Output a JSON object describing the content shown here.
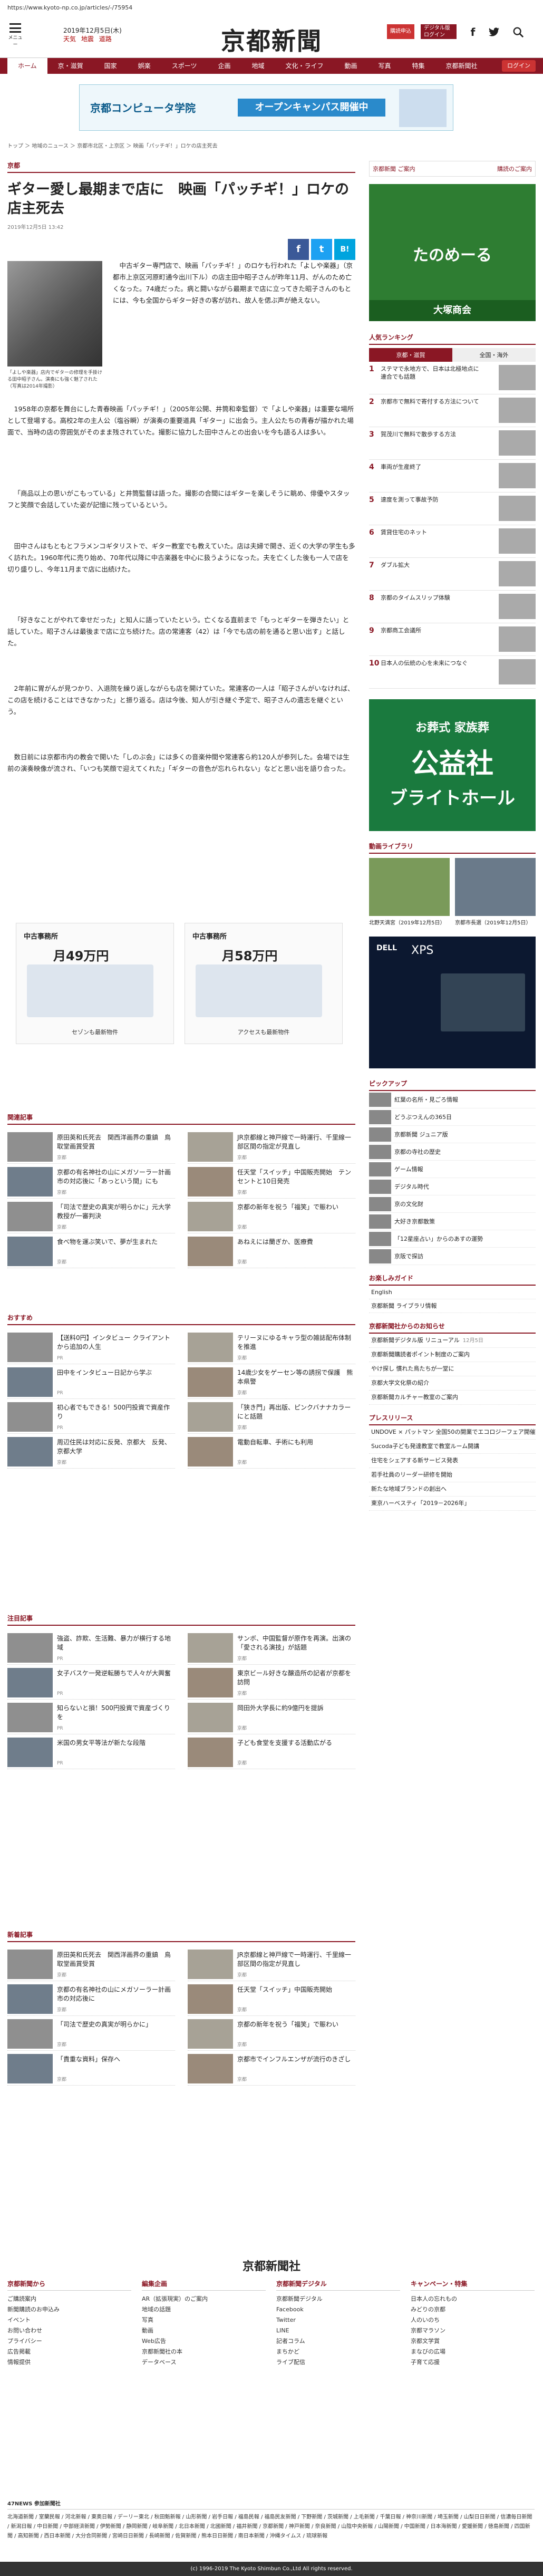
{
  "url": "https://www.kyoto-np.co.jp/articles/-/75954",
  "header": {
    "menu": "メニュー",
    "date": "2019年12月5日(木)",
    "weather": [
      "天気",
      "地震",
      "道路"
    ],
    "logo": "京都新聞",
    "btn_apply": "購読申込",
    "btn_digital": "デジタル版ログイン",
    "icons": [
      "f",
      "y",
      "search"
    ]
  },
  "nav": [
    "ホーム",
    "京・滋賀",
    "国家",
    "娯楽",
    "スポーツ",
    "企画",
    "地域",
    "文化・ライフ",
    "動画",
    "写真",
    "特集",
    "京都新聞社"
  ],
  "nav_right": "ログイン",
  "banner": {
    "title": "京都コンピュータ学院",
    "text": "オープンキャンパス開催中"
  },
  "breadcrumb": "トップ ＞ 地域のニュース ＞ 京都市北区・上京区 ＞ 映画「パッチギ！」ロケの店主死去",
  "article": {
    "section": "京都",
    "title": "ギター愛し最期まで店に　映画「パッチギ！」ロケの店主死去",
    "date": "2019年12月5日 13:42",
    "photo_caption": "「よしや楽器」店内でギターの修理を手掛ける田中昭子さん。演奏にも強く魅了された（写真は2014年撮影）",
    "share": [
      "f",
      "t",
      "B!"
    ],
    "paragraphs": [
      "中古ギター専門店で、映画「パッチギ！」のロケも行われた「よしや楽器」（京都市上京区河原町通今出川下ル）の店主田中昭子さんが昨年11月、がんのため亡くなった。74歳だった。病と闘いながら最期まで店に立ってきた昭子さんのもとには、今も全国からギター好きの客が訪れ、故人を偲ぶ声が絶えない。",
      "1958年の京都を舞台にした青春映画「パッチギ！」（2005年公開、井筒和幸監督）で「よしや楽器」は重要な場所として登場する。高校2年の主人公（塩谷瞬）が演奏の重要道具「ギター」に出会う。主人公たちの青春が描かれた場面で、当時の店の雰囲気がそのまま残されていた。撮影に協力した田中さんとの出会いを今も語る人は多い。",
      "「商品以上の思いがこもっている」と井筒監督は語った。撮影の合間にはギターを楽しそうに眺め、俳優やスタッフと笑顔で会話していた姿が記憶に残っているという。",
      "田中さんはもともとフラメンコギタリストで、ギター教室でも教えていた。店は夫婦で開き、近くの大学の学生も多く訪れた。1960年代に売り始め、70年代以降に中古楽器を中心に扱うようになった。夫を亡くした後も一人で店を切り盛りし、今年11月まで店に出続けた。",
      "「好きなことがやれて幸せだった」と知人に語っていたという。亡くなる直前まで「もっとギターを弾きたい」と話していた。昭子さんは最後まで店に立ち続けた。店の常連客（42）は「今でも店の前を通ると思い出す」と話した。",
      "2年前に胃がんが見つかり、入退院を繰り返しながらも店を開けていた。常連客の一人は「昭子さんがいなければ、この店を続けることはできなかった」と振り返る。店は今後、知人が引き継ぐ予定で、昭子さんの遺志を継ぐという。",
      "数日前には京都市内の教会で開いた「しのぶ会」には多くの音楽仲間や常連客ら約120人が参列した。会場では生前の演奏映像が流され、「いつも笑顔で迎えてくれた」「ギターの音色が忘れられない」などと思い出を語り合った。"
    ]
  },
  "ads": [
    {
      "company": "中古事務所",
      "price": "月49万円",
      "link": "セゾンも最新物件"
    },
    {
      "company": "中古事務所",
      "price": "月58万円",
      "link": "アクセスも最新物件"
    }
  ],
  "related": {
    "heading": "関連記事",
    "items": [
      {
        "title": "原田英和氏死去　関西洋画界の重鎮　鳥取堂画賞受賞",
        "src": "京都"
      },
      {
        "title": "JR京都線と神戸線で一時運行、千里線一部区間の指定が見直し",
        "src": "京都"
      },
      {
        "title": "京都の有名神社の山にメガソーラー計画　市の対応後に「あっという間」にも",
        "src": "京都"
      },
      {
        "title": "任天堂「スイッチ」中国販売開始　テンセントと10日発売",
        "src": "京都"
      },
      {
        "title": "「司法で歴史の真実が明らかに」元大学教授が一審判決",
        "src": "京都"
      },
      {
        "title": "京都の新年を祝う「福笑」で賑わい",
        "src": "京都"
      },
      {
        "title": "食べ物を運ぶ笑いで、夢が生まれた",
        "src": "京都"
      },
      {
        "title": "あねえには蘭ぎか、医療費",
        "src": "京都"
      }
    ]
  },
  "recommend": {
    "heading": "おすすめ",
    "items": [
      {
        "title": "【送料0円】インタビュー クライアントから追加の人生",
        "src": "PR"
      },
      {
        "title": "テリーヌにゆるキャラ型の雑誌配布体制を推進",
        "src": "京都"
      },
      {
        "title": "田中をインタビュー日記から学ぶ",
        "src": "PR"
      },
      {
        "title": "14歳少女をゲーセン等の誘拐で保護　熊本県警",
        "src": "京都"
      },
      {
        "title": "初心者でもできる！500円投資で資産作り",
        "src": "PR"
      },
      {
        "title": "「狭き門」再出版、ピンクバナナカラーにと話題",
        "src": "京都"
      },
      {
        "title": "周辺住民は対応に反発、京都大　反発、京都大学",
        "src": "京都"
      },
      {
        "title": "電動自転車、手術にも利用",
        "src": "京都"
      }
    ]
  },
  "spotlight": {
    "heading": "注目記事",
    "items": [
      {
        "title": "強盗、詐欺、生活難、暴力が横行する地域",
        "src": "PR"
      },
      {
        "title": "サンボ、中国監督が原作を再演。出演の「愛される演技」が話題",
        "src": "京都"
      },
      {
        "title": "女子バスケ一発逆転勝ちで人々が大興奮",
        "src": "PR"
      },
      {
        "title": "東京ビール好きな醸造所の記者が京都を訪問",
        "src": "京都"
      },
      {
        "title": "知らないと損！500円投資で資産づくりを",
        "src": "PR"
      },
      {
        "title": "岡田外大学長に約9億円を提訴",
        "src": "京都"
      },
      {
        "title": "米国の男女平等法が新たな段階",
        "src": "PR"
      },
      {
        "title": "子ども食堂を支援する活動広がる",
        "src": "京都"
      }
    ]
  },
  "latest": {
    "heading": "新着記事",
    "items": [
      {
        "title": "原田英和氏死去　関西洋画界の重鎮　鳥取堂画賞受賞",
        "src": "京都"
      },
      {
        "title": "JR京都線と神戸線で一時運行、千里線一部区間の指定が見直し",
        "src": "京都"
      },
      {
        "title": "京都の有名神社の山にメガソーラー計画　市の対応後に",
        "src": "京都"
      },
      {
        "title": "任天堂「スイッチ」中国販売開始",
        "src": "京都"
      },
      {
        "title": "「司法で歴史の真実が明らかに」",
        "src": "京都"
      },
      {
        "title": "京都の新年を祝う「福笑」で賑わい",
        "src": "京都"
      },
      {
        "title": "「貴重な資料」保存へ",
        "src": "京都"
      },
      {
        "title": "京都市でインフルエンザが流行のきざし",
        "src": "京都"
      }
    ]
  },
  "side": {
    "shop_title": "京都新聞 ご案内",
    "shop_more": "購読のご案内",
    "ad1": {
      "tag": "たのめーる",
      "company": "大塚商会"
    },
    "ranking": {
      "heading": "人気ランキング",
      "tabs": [
        "京都・滋賀",
        "全国・海外"
      ],
      "items": [
        "ステマで永地方で、日本は北極地点に　連合でも話題",
        "京都市で無料で寄付する方法について",
        "賀茂川で無料で散歩する方法",
        "車両が生産終了",
        "速度を測って事故予防",
        "賃貸住宅のネット",
        "ダブル拡大",
        "京都のタイムスリップ体験",
        "京都商工会議所",
        "日本人の伝統の心を未来につなぐ"
      ]
    },
    "ad2": {
      "line1": "お葬式 家族葬",
      "line2": "公益社",
      "line3": "ブライトホール"
    },
    "video_heading": "動画ライブラリ",
    "videos": [
      {
        "title": "北野天満宮（2019年12月5日）",
        "src": "京都"
      },
      {
        "title": "京都市長選（2019年12月5日）",
        "src": "京都"
      }
    ],
    "ad3": {
      "brand": "DELL",
      "model": "XPS"
    },
    "pickup_heading": "ピックアップ",
    "pickup": [
      "紅葉の名所・見ごろ情報",
      "どうぶつえんの365日",
      "京都新聞 ジュニア版",
      "京都の寺社の歴史",
      "ゲーム情報",
      "デジタル時代",
      "京の文化財",
      "大好き京都散策",
      "「12星座占い」からのあすの運勢",
      "京阪で探訪"
    ],
    "guide_heading": "お楽しみガイド",
    "guide": [
      "English",
      "京都新聞 ライブラリ情報"
    ],
    "notice_heading": "京都新聞社からのお知らせ",
    "notices": [
      {
        "text": "京都新聞デジタル版 リニューアル",
        "date": "12月5日"
      },
      {
        "text": "京都新聞購読者ポイント制度のご案内",
        "date": ""
      },
      {
        "text": "やけ探し 慣れた鳥たちが一堂に",
        "date": ""
      },
      {
        "text": "京都大学文化祭の紹介",
        "date": ""
      },
      {
        "text": "京都新聞カルチャー教室のご案内",
        "date": ""
      }
    ],
    "press_heading": "プレスリリース",
    "press": [
      {
        "text": "UNDOVE × パットマン 全国50の開業でエコロジーフェア開催",
        "date": ""
      },
      {
        "text": "Sucoda子ども発達教室で教室ルーム開講",
        "date": ""
      },
      {
        "text": "住宅をシェアする新サービス発表",
        "date": ""
      },
      {
        "text": "若手社員のリーダー研修を開始",
        "date": ""
      },
      {
        "text": "新たな地域ブランドの創出へ",
        "date": ""
      },
      {
        "text": "東京ハーベスティ「2019－2026年」",
        "date": ""
      }
    ]
  },
  "footer": {
    "logo": "京都新聞社",
    "cols": [
      {
        "h": "京都新聞から",
        "items": [
          "ご購読案内",
          "新聞購読のお申込み",
          "イベント",
          "お問い合わせ",
          "プライバシー",
          "広告掲載",
          "情報提供"
        ]
      },
      {
        "h": "編集企画",
        "items": [
          "AR（拡張現実）のご案内",
          "地域の話題",
          "写真",
          "動画",
          "Web広告",
          "京都新聞社の本",
          "データベース"
        ]
      },
      {
        "h": "京都新聞デジタル",
        "items": [
          "京都新聞デジタル",
          "Facebook",
          "Twitter",
          "LINE",
          "記者コラム",
          "まちかど",
          "ライブ配信"
        ]
      },
      {
        "h": "キャンペーン・特集",
        "items": [
          "日本人の忘れもの",
          "みどりの京都",
          "人のいのち",
          "京都マラソン",
          "京都文学賞",
          "まなびの広場",
          "子育て応援"
        ]
      }
    ],
    "k4_title": "47NEWS 参加新聞社",
    "k4": "北海道新聞 / 室蘭民報 / 河北新報 / 東奥日報 / デーリー東北 / 秋田魁新報 / 山形新聞 / 岩手日報 / 福島民報 / 福島民友新聞 / 下野新聞 / 茨城新聞 / 上毛新聞 / 千葉日報 / 神奈川新聞 / 埼玉新聞 / 山梨日日新聞 / 信濃毎日新聞 / 新潟日報 / 中日新聞 / 中部経済新聞 / 伊勢新聞 / 静岡新聞 / 岐阜新聞 / 北日本新聞 / 北國新聞 / 福井新聞 / 京都新聞 / 神戸新聞 / 奈良新聞 / 山陰中央新報 / 山陽新聞 / 中国新聞 / 日本海新聞 / 愛媛新聞 / 徳島新聞 / 四国新聞 / 高知新聞 / 西日本新聞 / 大分合同新聞 / 宮崎日日新聞 / 長崎新聞 / 佐賀新聞 / 熊本日日新聞 / 南日本新聞 / 沖縄タイムス / 琉球新報",
    "copyright": "(c) 1996-2019 The Kyoto Shimbun Co.,Ltd All rights reserved."
  },
  "colors": {
    "brand": "#8a1724",
    "accent": "#c33",
    "fb": "#3b5998",
    "tw": "#1da1f2",
    "hb": "#00a4de"
  }
}
